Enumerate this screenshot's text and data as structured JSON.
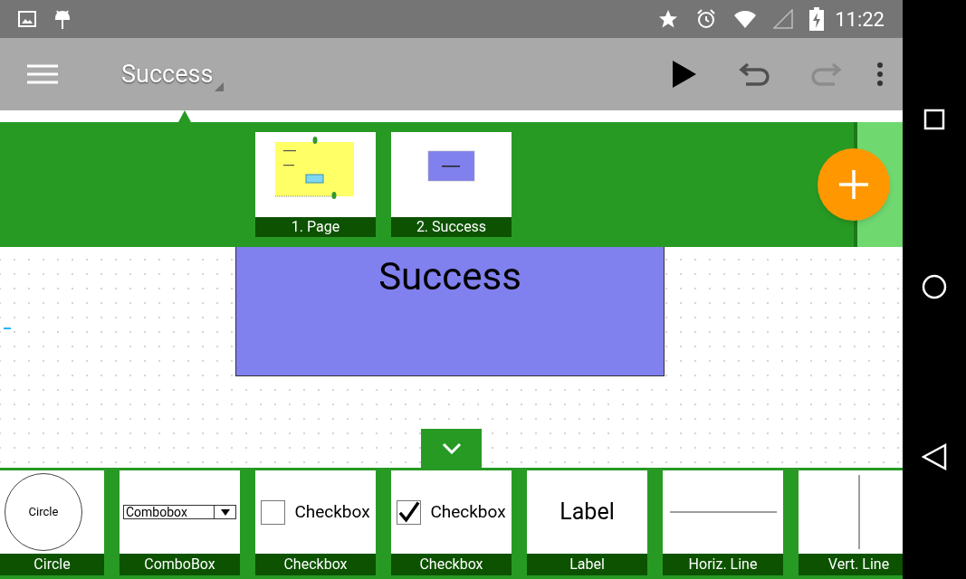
{
  "status_bar": {
    "time": "11:22"
  },
  "toolbar": {
    "title": "Success",
    "undo_disabled": false,
    "redo_disabled": true
  },
  "pages": [
    {
      "label": "1. Page",
      "kind": "form"
    },
    {
      "label": "2. Success",
      "kind": "success"
    }
  ],
  "canvas": {
    "box_text": "Success"
  },
  "palette": [
    {
      "kind": "circle",
      "preview": "Circle",
      "label": "Circle"
    },
    {
      "kind": "combobox",
      "preview": "Combobox",
      "label": "ComboBox"
    },
    {
      "kind": "checkbox",
      "preview": "Checkbox",
      "checked": false,
      "label": "Checkbox"
    },
    {
      "kind": "checkbox",
      "preview": "Checkbox",
      "checked": true,
      "label": "Checkbox"
    },
    {
      "kind": "label",
      "preview": "Label",
      "label": "Label"
    },
    {
      "kind": "hline",
      "label": "Horiz. Line"
    },
    {
      "kind": "vline",
      "label": "Vert. Line"
    }
  ]
}
